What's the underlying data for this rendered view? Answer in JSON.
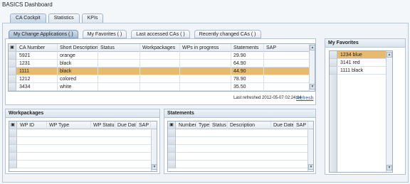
{
  "app": {
    "title": "BASICS Dashboard"
  },
  "main_tabs": [
    "CA Cockpit",
    "Statistics",
    "KPIs"
  ],
  "sub_tabs": [
    "My Change Applications ( )",
    "My Favorites ( )",
    "Last accessed CAs ( )",
    "Recently changed CAs ( )"
  ],
  "ca_table": {
    "columns": [
      "CA Number",
      "Short Description",
      "Status",
      "Workpackages",
      "WPs in progress",
      "Statements",
      "SAP"
    ],
    "rows": [
      [
        "5921",
        "orange",
        "",
        "",
        "",
        "29.90",
        ""
      ],
      [
        "1231",
        "black",
        "",
        "",
        "",
        "64.90",
        ""
      ],
      [
        "1111",
        "black",
        "",
        "",
        "",
        "44.90",
        ""
      ],
      [
        "1212",
        "colored",
        "",
        "",
        "",
        "78.90",
        ""
      ],
      [
        "3434",
        "white",
        "",
        "",
        "",
        "35.50",
        ""
      ]
    ],
    "selected_row": 2,
    "last_refreshed": "Last refreshed 2012-05-07 02:24:14",
    "refresh_link": "Refresh"
  },
  "workpackages": {
    "title": "Workpackages",
    "columns": [
      "WP ID",
      "WP Type",
      "WP Status",
      "Due Date",
      "SAP"
    ]
  },
  "statements": {
    "title": "Statements",
    "columns": [
      "Number",
      "Type",
      "Status",
      "Description",
      "Due Date",
      "SAP"
    ]
  },
  "favorites": {
    "title": "My Favorites",
    "items": [
      "1234 blue",
      "3141 red",
      "1111 black"
    ],
    "selected_item": 0
  },
  "colors": {
    "selection": "#e7bb6e",
    "link": "#2a5db0"
  }
}
